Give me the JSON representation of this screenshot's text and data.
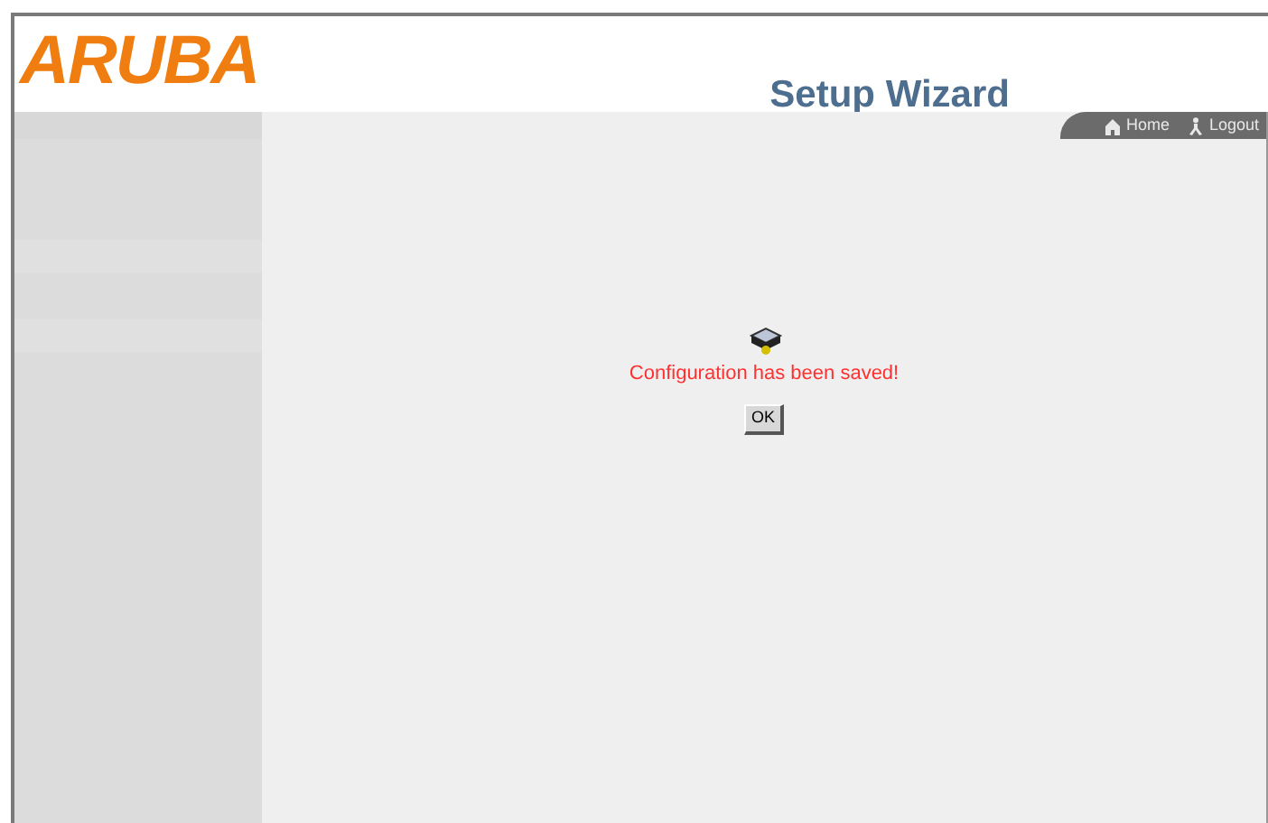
{
  "header": {
    "logo": "ARUBA",
    "title": "Setup Wizard"
  },
  "nav": [
    {
      "label": "Home",
      "kind": "home"
    },
    {
      "label": "Logout",
      "kind": "logout"
    }
  ],
  "message": {
    "text": "Configuration has been saved!",
    "button": "OK"
  }
}
